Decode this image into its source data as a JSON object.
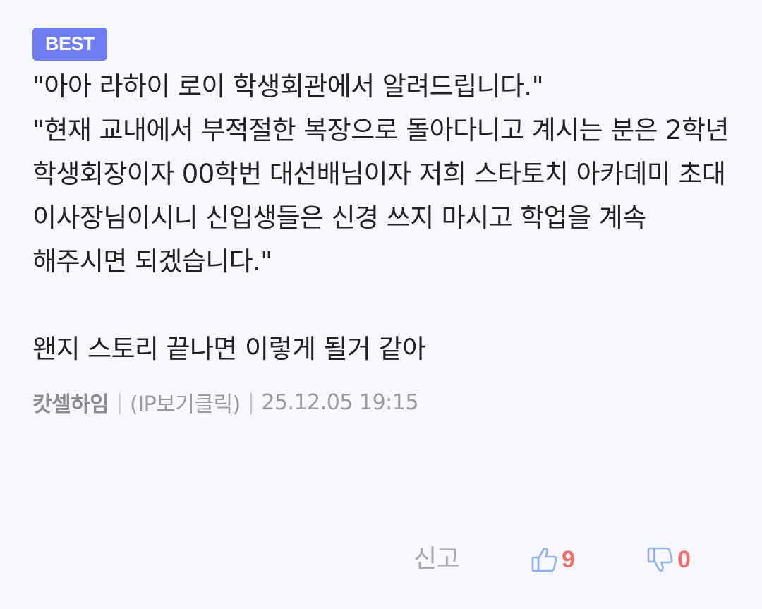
{
  "badge": "BEST",
  "paragraphs": [
    "\"아아 라하이 로이 학생회관에서 알려드립니다.\"",
    "\"현재 교내에서 부적절한 복장으로 돌아다니고 계시는 분은 2학년 학생회장이자 00학번 대선배님이자 저희 스타토치 아카데미 초대 이사장님이시니 신입생들은 신경 쓰지 마시고 학업을 계속 해주시면 되겠습니다.\"",
    "왠지 스토리 끝나면 이렇게 될거 같아"
  ],
  "meta": {
    "nickname": "캇셀하임",
    "separator": "|",
    "ip_label": "(IP보기클릭)",
    "datetime": "25.12.05 19:15"
  },
  "actions": {
    "report_label": "신고",
    "upvote_count": "9",
    "downvote_count": "0"
  },
  "colors": {
    "badge": "#6f7df2",
    "vote_count": "#ee6f6a",
    "thumb_icon": "#8fb0f0"
  }
}
